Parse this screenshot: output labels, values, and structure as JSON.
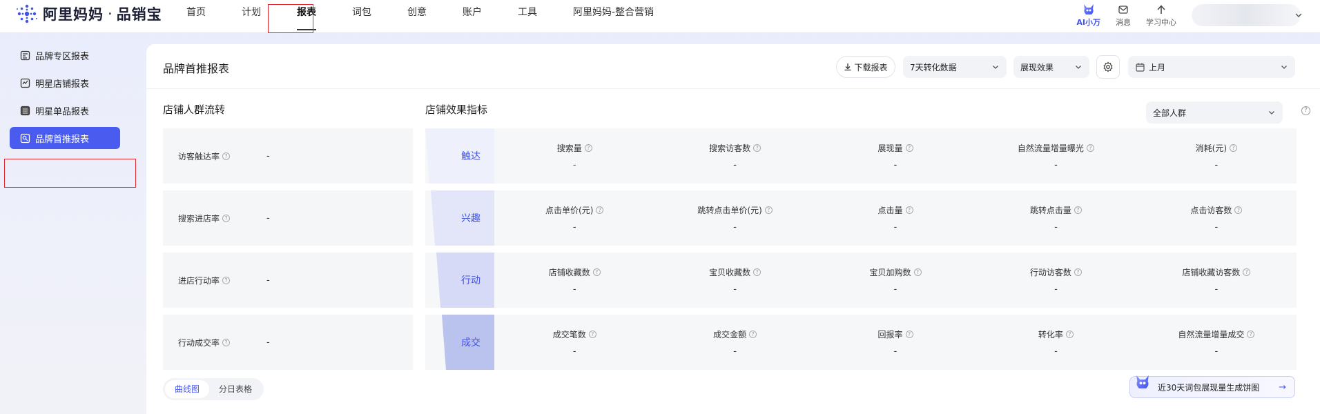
{
  "brand": {
    "name": "阿里妈妈",
    "separator": "·",
    "product": "品销宝"
  },
  "nav": {
    "items": [
      {
        "label": "首页"
      },
      {
        "label": "计划"
      },
      {
        "label": "报表"
      },
      {
        "label": "词包"
      },
      {
        "label": "创意"
      },
      {
        "label": "账户"
      },
      {
        "label": "工具"
      },
      {
        "label": "阿里妈妈-整合营销"
      }
    ],
    "active_index": 2
  },
  "top_right": {
    "ai_label": "AI小万",
    "messages_label": "消息",
    "learning_label": "学习中心"
  },
  "sidebar": {
    "items": [
      {
        "label": "品牌专区报表",
        "icon": "report-icon"
      },
      {
        "label": "明星店铺报表",
        "icon": "store-report-icon"
      },
      {
        "label": "明星单品报表",
        "icon": "product-report-icon"
      },
      {
        "label": "品牌首推报表",
        "icon": "brand-report-icon"
      }
    ],
    "active_index": 3
  },
  "panel": {
    "title": "品牌首推报表",
    "download_label": "下载报表",
    "conversion_select": "7天转化数据",
    "effect_select": "展现效果",
    "date_select": "上月",
    "crowd_select": "全部人群"
  },
  "funnel": {
    "title": "店铺人群流转",
    "rows": [
      {
        "label": "访客触达率",
        "value": "-"
      },
      {
        "label": "搜索进店率",
        "value": "-"
      },
      {
        "label": "进店行动率",
        "value": "-"
      },
      {
        "label": "行动成交率",
        "value": "-"
      }
    ]
  },
  "metrics": {
    "title": "店铺效果指标",
    "stages": [
      {
        "label": "触达",
        "color": "#eef0fb",
        "items": [
          {
            "name": "搜索量",
            "value": "-"
          },
          {
            "name": "搜索访客数",
            "value": "-"
          },
          {
            "name": "展现量",
            "value": "-"
          },
          {
            "name": "自然流量增量曝光",
            "value": "-"
          },
          {
            "name": "消耗(元)",
            "value": "-"
          }
        ]
      },
      {
        "label": "兴趣",
        "color": "#e3e6f8",
        "items": [
          {
            "name": "点击单价(元)",
            "value": "-"
          },
          {
            "name": "跳转点击单价(元)",
            "value": "-"
          },
          {
            "name": "点击量",
            "value": "-"
          },
          {
            "name": "跳转点击量",
            "value": "-"
          },
          {
            "name": "点击访客数",
            "value": "-"
          }
        ]
      },
      {
        "label": "行动",
        "color": "#d6daf6",
        "items": [
          {
            "name": "店铺收藏数",
            "value": "-"
          },
          {
            "name": "宝贝收藏数",
            "value": "-"
          },
          {
            "name": "宝贝加购数",
            "value": "-"
          },
          {
            "name": "行动访客数",
            "value": "-"
          },
          {
            "name": "店铺收藏访客数",
            "value": "-"
          }
        ]
      },
      {
        "label": "成交",
        "color": "#bac2ee",
        "items": [
          {
            "name": "成交笔数",
            "value": "-"
          },
          {
            "name": "成交金额",
            "value": "-"
          },
          {
            "name": "回报率",
            "value": "-"
          },
          {
            "name": "转化率",
            "value": "-"
          },
          {
            "name": "自然流量增量成交",
            "value": "-"
          }
        ]
      }
    ]
  },
  "bottom": {
    "tabs": [
      {
        "label": "曲线图"
      },
      {
        "label": "分日表格"
      }
    ],
    "active_tab": 0,
    "ai_suggestion": "近30天词包展现量生成饼图",
    "ai_arrow": "→"
  },
  "colors": {
    "accent": "#4a5cf0",
    "highlight_box": "#e0282e"
  }
}
